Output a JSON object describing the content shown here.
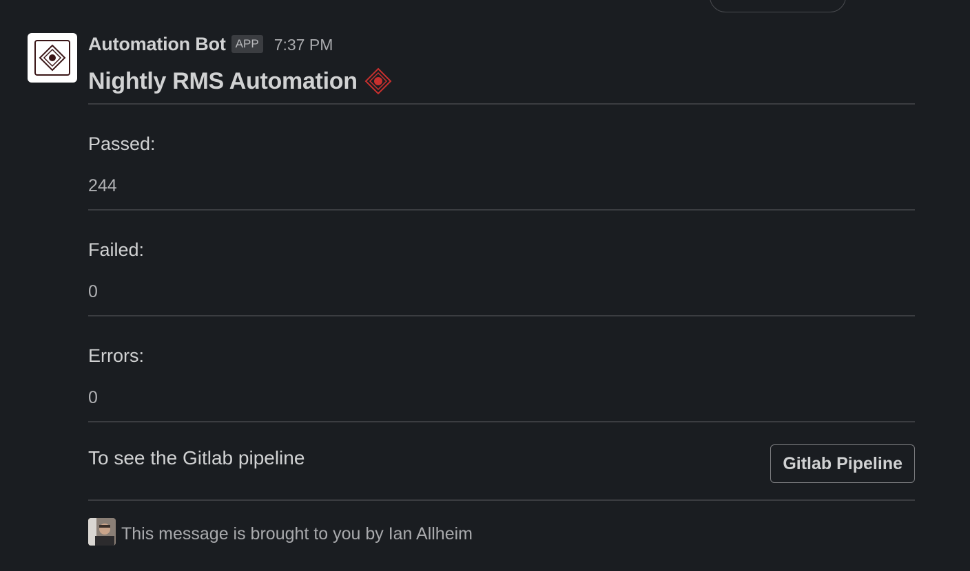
{
  "message": {
    "sender": "Automation Bot",
    "badge": "APP",
    "timestamp": "7:37 PM",
    "avatar_icon": "compass-diamond-icon",
    "title": "Nightly RMS Automation",
    "title_icon": "compass-diamond-icon",
    "title_icon_color": "#c8302e",
    "fields": [
      {
        "label": "Passed:",
        "value": "244"
      },
      {
        "label": "Failed:",
        "value": "0"
      },
      {
        "label": "Errors:",
        "value": "0"
      }
    ],
    "action": {
      "text": "To see the Gitlab pipeline",
      "button_label": "Gitlab Pipeline"
    },
    "context": {
      "avatar_icon": "user-photo-avatar",
      "text": "This message is brought to you by Ian Allheim"
    }
  },
  "theme": {
    "background": "#1a1d21",
    "text": "#d1d2d3",
    "divider": "#3b3d41"
  }
}
